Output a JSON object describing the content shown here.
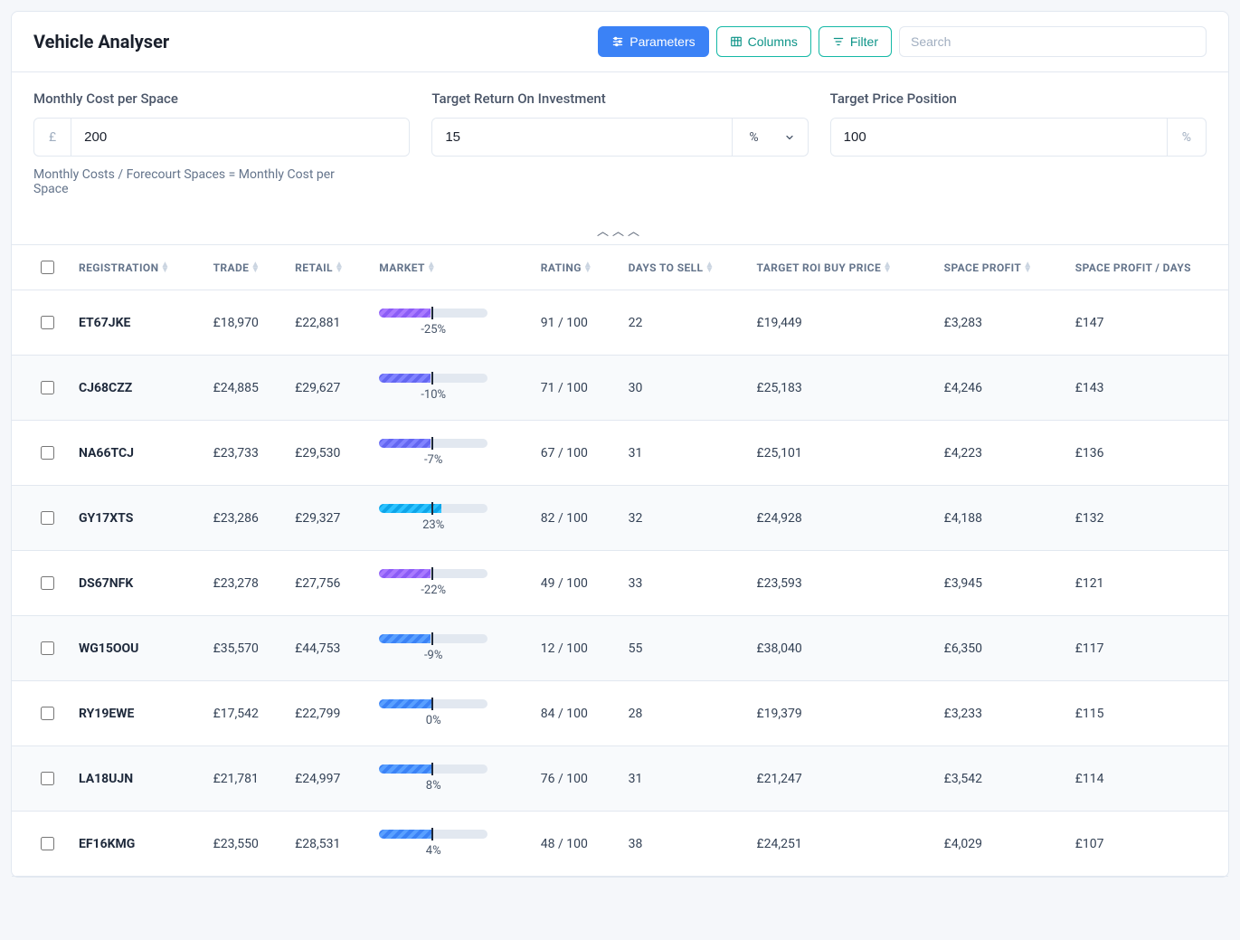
{
  "header": {
    "title": "Vehicle Analyser",
    "parameters_label": "Parameters",
    "columns_label": "Columns",
    "filter_label": "Filter",
    "search_placeholder": "Search"
  },
  "params": {
    "cost_label": "Monthly Cost per Space",
    "cost_currency": "£",
    "cost_value": "200",
    "cost_helper": "Monthly Costs / Forecourt Spaces = Monthly Cost per Space",
    "roi_label": "Target Return On Investment",
    "roi_value": "15",
    "roi_unit": "%",
    "price_label": "Target Price Position",
    "price_value": "100",
    "price_unit": "%"
  },
  "table": {
    "headers": {
      "registration": "Registration",
      "trade": "Trade",
      "retail": "Retail",
      "market": "Market",
      "rating": "Rating",
      "days_to_sell": "Days To Sell",
      "target_roi": "Target ROI Buy Price",
      "space_profit": "Space Profit",
      "space_profit_days": "Space Profit / Days"
    },
    "rows": [
      {
        "registration": "ET67JKE",
        "trade": "£18,970",
        "retail": "£22,881",
        "market_pct": "-25%",
        "market_fill": 47,
        "market_color": "#8b5cf6",
        "rating": "91 / 100",
        "days": "22",
        "roi": "£19,449",
        "profit": "£3,283",
        "profit_days": "£147"
      },
      {
        "registration": "CJ68CZZ",
        "trade": "£24,885",
        "retail": "£29,627",
        "market_pct": "-10%",
        "market_fill": 47,
        "market_color": "#6366f1",
        "rating": "71 / 100",
        "days": "30",
        "roi": "£25,183",
        "profit": "£4,246",
        "profit_days": "£143"
      },
      {
        "registration": "NA66TCJ",
        "trade": "£23,733",
        "retail": "£29,530",
        "market_pct": "-7%",
        "market_fill": 47,
        "market_color": "#6366f1",
        "rating": "67 / 100",
        "days": "31",
        "roi": "£25,101",
        "profit": "£4,223",
        "profit_days": "£136"
      },
      {
        "registration": "GY17XTS",
        "trade": "£23,286",
        "retail": "£29,327",
        "market_pct": "23%",
        "market_fill": 57,
        "market_color": "#0ea5e9",
        "rating": "82 / 100",
        "days": "32",
        "roi": "£24,928",
        "profit": "£4,188",
        "profit_days": "£132"
      },
      {
        "registration": "DS67NFK",
        "trade": "£23,278",
        "retail": "£27,756",
        "market_pct": "-22%",
        "market_fill": 47,
        "market_color": "#8b5cf6",
        "rating": "49 / 100",
        "days": "33",
        "roi": "£23,593",
        "profit": "£3,945",
        "profit_days": "£121"
      },
      {
        "registration": "WG15OOU",
        "trade": "£35,570",
        "retail": "£44,753",
        "market_pct": "-9%",
        "market_fill": 47,
        "market_color": "#3b82f6",
        "rating": "12 / 100",
        "days": "55",
        "roi": "£38,040",
        "profit": "£6,350",
        "profit_days": "£117"
      },
      {
        "registration": "RY19EWE",
        "trade": "£17,542",
        "retail": "£22,799",
        "market_pct": "0%",
        "market_fill": 48,
        "market_color": "#3b82f6",
        "rating": "84 / 100",
        "days": "28",
        "roi": "£19,379",
        "profit": "£3,233",
        "profit_days": "£115"
      },
      {
        "registration": "LA18UJN",
        "trade": "£21,781",
        "retail": "£24,997",
        "market_pct": "8%",
        "market_fill": 48,
        "market_color": "#3b82f6",
        "rating": "76 / 100",
        "days": "31",
        "roi": "£21,247",
        "profit": "£3,542",
        "profit_days": "£114"
      },
      {
        "registration": "EF16KMG",
        "trade": "£23,550",
        "retail": "£28,531",
        "market_pct": "4%",
        "market_fill": 48,
        "market_color": "#3b82f6",
        "rating": "48 / 100",
        "days": "38",
        "roi": "£24,251",
        "profit": "£4,029",
        "profit_days": "£107"
      }
    ]
  }
}
